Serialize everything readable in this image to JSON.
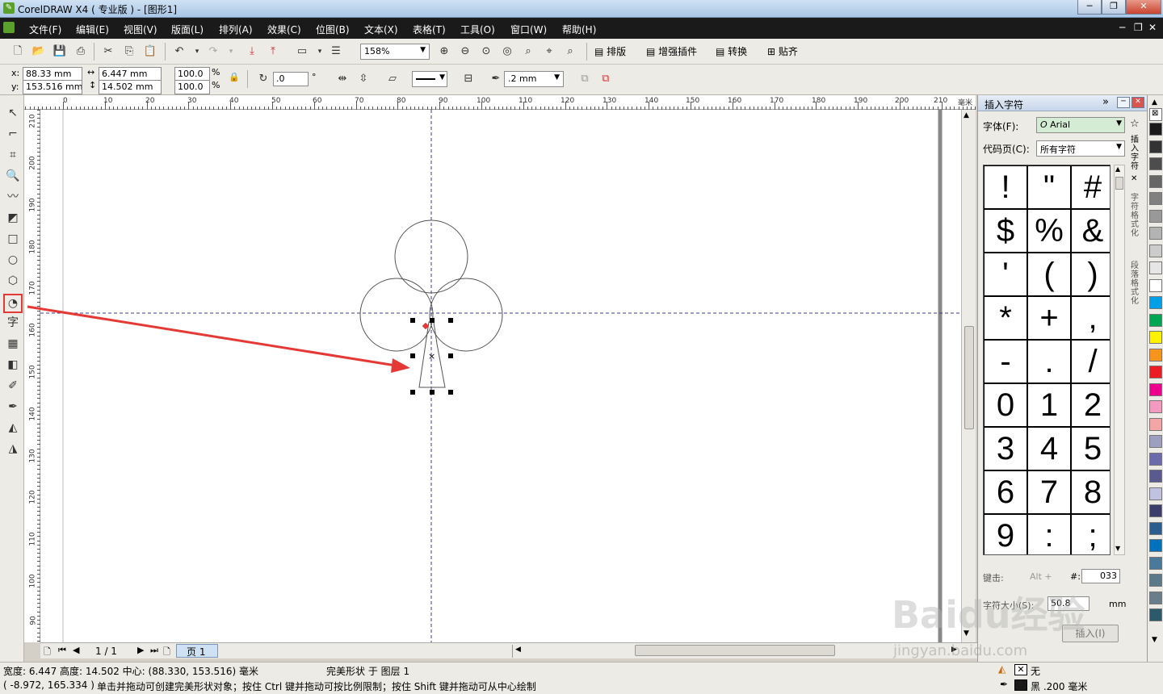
{
  "title": "CorelDRAW X4 ( 专业版 ) - [图形1]",
  "menu": [
    "文件(F)",
    "编辑(E)",
    "视图(V)",
    "版面(L)",
    "排列(A)",
    "效果(C)",
    "位图(B)",
    "文本(X)",
    "表格(T)",
    "工具(O)",
    "窗口(W)",
    "帮助(H)"
  ],
  "toolbar": {
    "zoom": "158%",
    "btn_layout": "排版",
    "btn_plugin": "增强插件",
    "btn_convert": "转换",
    "btn_snap": "贴齐"
  },
  "props": {
    "x": "88.33 mm",
    "y": "153.516 mm",
    "w": "6.447 mm",
    "h": "14.502 mm",
    "sx": "100.0",
    "sy": "100.0",
    "pct1": "%",
    "pct2": "%",
    "angle": ".0",
    "deg": "°",
    "outline": ".2 mm"
  },
  "hruler": {
    "labels": [
      "0",
      "10",
      "20",
      "30",
      "40",
      "50",
      "60",
      "70",
      "80",
      "90",
      "100",
      "110",
      "120",
      "130",
      "140",
      "150",
      "160",
      "170",
      "180",
      "190",
      "200",
      "210"
    ],
    "unit": "毫米"
  },
  "vruler": {
    "labels": [
      "210",
      "200",
      "190",
      "180",
      "170",
      "160",
      "150",
      "140",
      "130",
      "120",
      "110",
      "100",
      "90"
    ]
  },
  "docker": {
    "title": "插入字符",
    "font_label": "字体(F):",
    "font_value": "Arial",
    "codepage_label": "代码页(C):",
    "codepage_value": "所有字符",
    "chars": [
      "!",
      "\"",
      "#",
      "$",
      "%",
      "&",
      "'",
      "(",
      ")",
      "*",
      "+",
      ",",
      "-",
      ".",
      "/",
      "0",
      "1",
      "2",
      "3",
      "4",
      "5",
      "6",
      "7",
      "8",
      "9",
      ":",
      ";"
    ],
    "key_label": "键击:",
    "alt_label": "Alt +",
    "hash_label": "#:",
    "code_value": "033",
    "size_label": "字符大小(S):",
    "size_value": "50.8",
    "size_unit": "mm",
    "insert_label": "插入(I)",
    "side_tabs": [
      "插入字符",
      "字符格式化",
      "段落格式化"
    ]
  },
  "pagebar": {
    "page_count": "1 / 1",
    "page_tab": "页 1"
  },
  "status": {
    "dims": "宽度: 6.447  高度: 14.502  中心: (88.330, 153.516)  毫米",
    "object": "完美形状 于 图层 1",
    "coords": "( -8.972, 165.334 )",
    "hint": "单击并拖动可创建完美形状对象；按住 Ctrl 键并拖动可按比例限制；按住 Shift 键并拖动可从中心绘制",
    "fill": "无",
    "outline": "黑  .200 毫米"
  },
  "palette": [
    "#1a1a1a",
    "#333333",
    "#4d4d4d",
    "#666666",
    "#808080",
    "#999999",
    "#b3b3b3",
    "#cccccc",
    "#e6e6e6",
    "#ffffff",
    "#00a0e9",
    "#00a651",
    "#fff200",
    "#f7941d",
    "#ed1c24",
    "#ec008c",
    "#f49ac1",
    "#f4a6a6",
    "#9e9ebf",
    "#6b6bab",
    "#5a5a8f",
    "#c1c1e0",
    "#3d3d6b",
    "#2b5d8f",
    "#0072bc",
    "#4a7a9a",
    "#5a7a8a",
    "#697e8a",
    "#2d5a6b"
  ],
  "watermark": {
    "brand": "Baidu经验",
    "url": "jingyan.baidu.com"
  }
}
